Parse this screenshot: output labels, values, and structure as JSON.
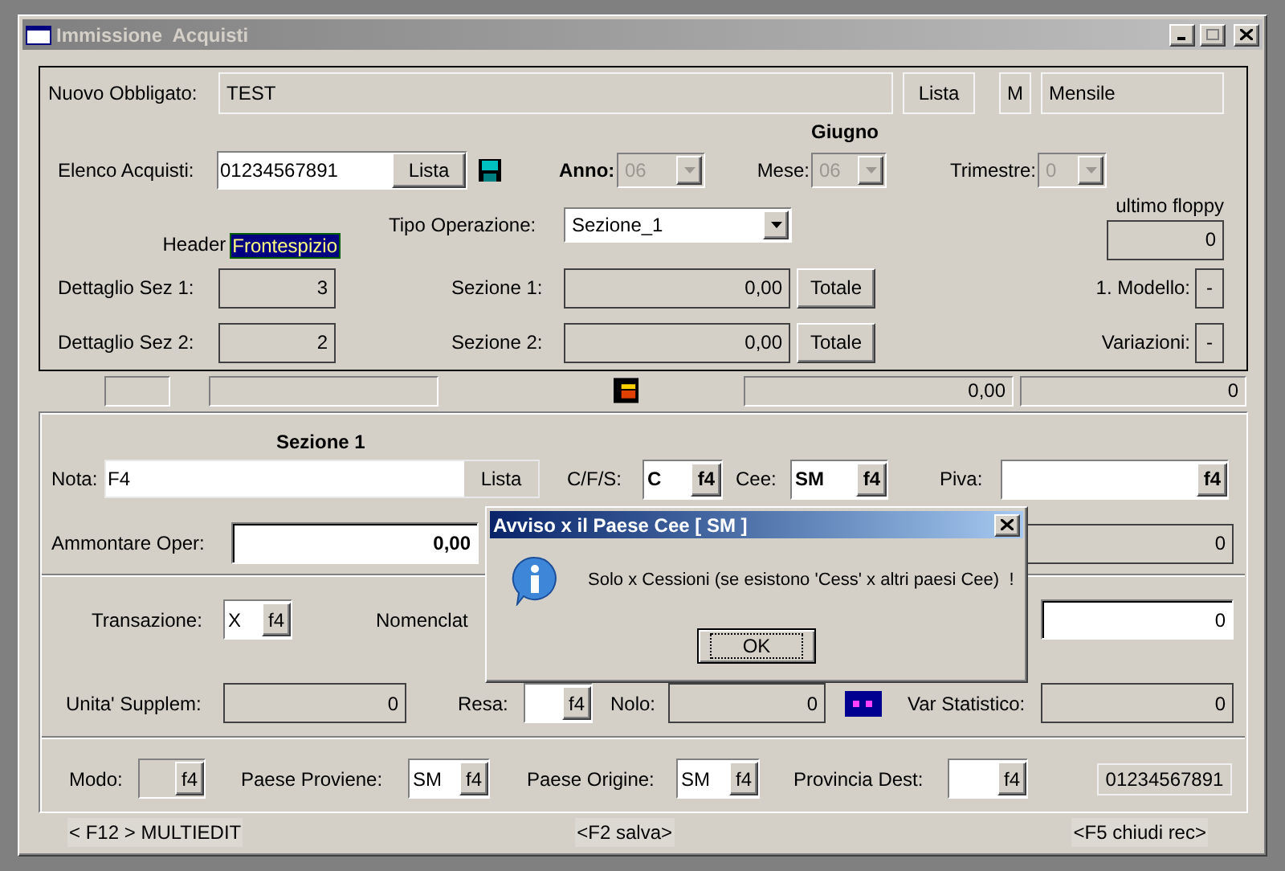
{
  "window": {
    "title": "Immissione  Acquisti"
  },
  "header_panel": {
    "obbligato": {
      "label": "Nuovo Obbligato:",
      "value": "TEST",
      "button": "Lista",
      "period_code": "M",
      "period": "Mensile"
    },
    "month_name": "Giugno",
    "elenco": {
      "label": "Elenco Acquisti:",
      "value": "01234567891",
      "button": "Lista"
    },
    "anno": {
      "label": "Anno:",
      "value": "06",
      "disabled": true
    },
    "mese": {
      "label": "Mese:",
      "value": "06",
      "disabled": true
    },
    "trimestre": {
      "label": "Trimestre:",
      "value": "0",
      "disabled": true
    },
    "ultimo_floppy": {
      "label": "ultimo floppy",
      "value": "0"
    },
    "tipo_operazione": {
      "label": "Tipo Operazione:",
      "value": "Sezione_1",
      "disabled": false
    },
    "header": {
      "label": "Header",
      "value": "Frontespizio"
    },
    "sections": [
      {
        "label": "Dettaglio Sez 1:",
        "count": "3",
        "section_label": "Sezione 1:",
        "amount": "0,00",
        "button": "Totale",
        "flag_label": "1. Modello:",
        "flag": "-"
      },
      {
        "label": "Dettaglio Sez 2:",
        "count": "2",
        "section_label": "Sezione 2:",
        "amount": "0,00",
        "button": "Totale",
        "flag_label": "Variazioni:",
        "flag": "-"
      }
    ]
  },
  "status_bar": {
    "amount": "0,00",
    "count": "0"
  },
  "section_panel": {
    "title": "Sezione 1",
    "nota": {
      "label": "Nota:",
      "value": "F4",
      "button": "Lista"
    },
    "cfs": {
      "label": "C/F/S:",
      "value": "C",
      "key": "f4",
      "highlighted": true,
      "disabled": false
    },
    "cee": {
      "label": "Cee:",
      "value": "SM",
      "key": "f4",
      "highlighted": true,
      "disabled": false
    },
    "piva": {
      "label": "Piva:",
      "key": "f4",
      "highlighted": true,
      "disabled": false
    },
    "ammontare": {
      "label": "Ammontare Oper:",
      "value": "0,00"
    },
    "ammontare_side": {
      "value": "0"
    },
    "transazione": {
      "label": "Transazione:",
      "value": "X",
      "key": "f4",
      "highlighted": false,
      "disabled": false
    },
    "nomenclatura": {
      "label": "Nomenclat"
    },
    "transazione_side": {
      "value": "0"
    },
    "unita": {
      "label": "Unita' Supplem:",
      "value": "0"
    },
    "resa": {
      "label": "Resa:",
      "key": "f4",
      "highlighted": false,
      "disabled": false
    },
    "nolo": {
      "label": "Nolo:",
      "value": "0"
    },
    "var_statistico": {
      "label": "Var Statistico:",
      "value": "0"
    },
    "modo": {
      "label": "Modo:",
      "key": "f4",
      "highlighted": false,
      "disabled": true
    },
    "paese_proviene": {
      "label": "Paese Proviene:",
      "value": "SM",
      "key": "f4",
      "highlighted": false,
      "disabled": false
    },
    "paese_origine": {
      "label": "Paese Origine:",
      "value": "SM",
      "key": "f4",
      "highlighted": false,
      "disabled": false
    },
    "provincia_dest": {
      "label": "Provincia Dest:",
      "key": "f4",
      "highlighted": false,
      "disabled": false
    },
    "elenco_ref": "01234567891"
  },
  "footer": [
    "< F12 > MULTIEDIT",
    "<F2 salva>",
    "<F5 chiudi rec>"
  ],
  "dialog": {
    "title": "Avviso x il Paese Cee [ SM ]",
    "message": "Solo x Cessioni (se esistono 'Cess' x altri paesi Cee)  !",
    "button": "OK"
  }
}
